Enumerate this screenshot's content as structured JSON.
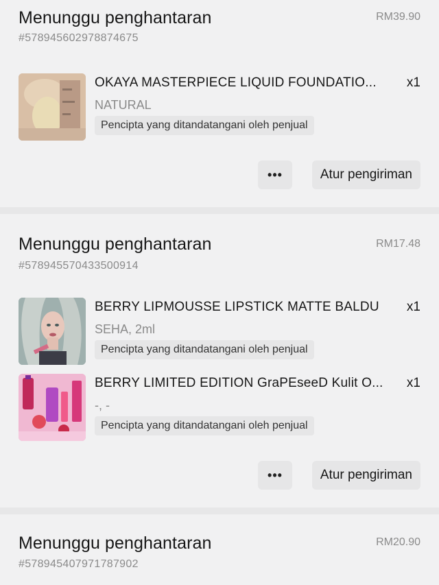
{
  "orders": [
    {
      "status": "Menunggu penghantaran",
      "price": "RM39.90",
      "order_id": "#578945602978874675",
      "items": [
        {
          "name": "OKAYA MASTERPIECE LIQUID FOUNDATIO...",
          "qty": "x1",
          "variant": "NATURAL",
          "tag": "Pencipta yang ditandatangani oleh penjual"
        }
      ],
      "more_label": "•••",
      "ship_label": "Atur pengiriman"
    },
    {
      "status": "Menunggu penghantaran",
      "price": "RM17.48",
      "order_id": "#578945570433500914",
      "items": [
        {
          "name": "BERRY LIPMOUSSE LIPSTICK MATTE BALDU",
          "qty": "x1",
          "variant": "SEHA, 2ml",
          "tag": "Pencipta yang ditandatangani oleh penjual"
        },
        {
          "name": "BERRY LIMITED EDITION GraPEseeD Kulit O...",
          "qty": "x1",
          "variant": "-, -",
          "tag": "Pencipta yang ditandatangani oleh penjual"
        }
      ],
      "more_label": "•••",
      "ship_label": "Atur pengiriman"
    },
    {
      "status": "Menunggu penghantaran",
      "price": "RM20.90",
      "order_id": "#578945407971787902"
    }
  ]
}
